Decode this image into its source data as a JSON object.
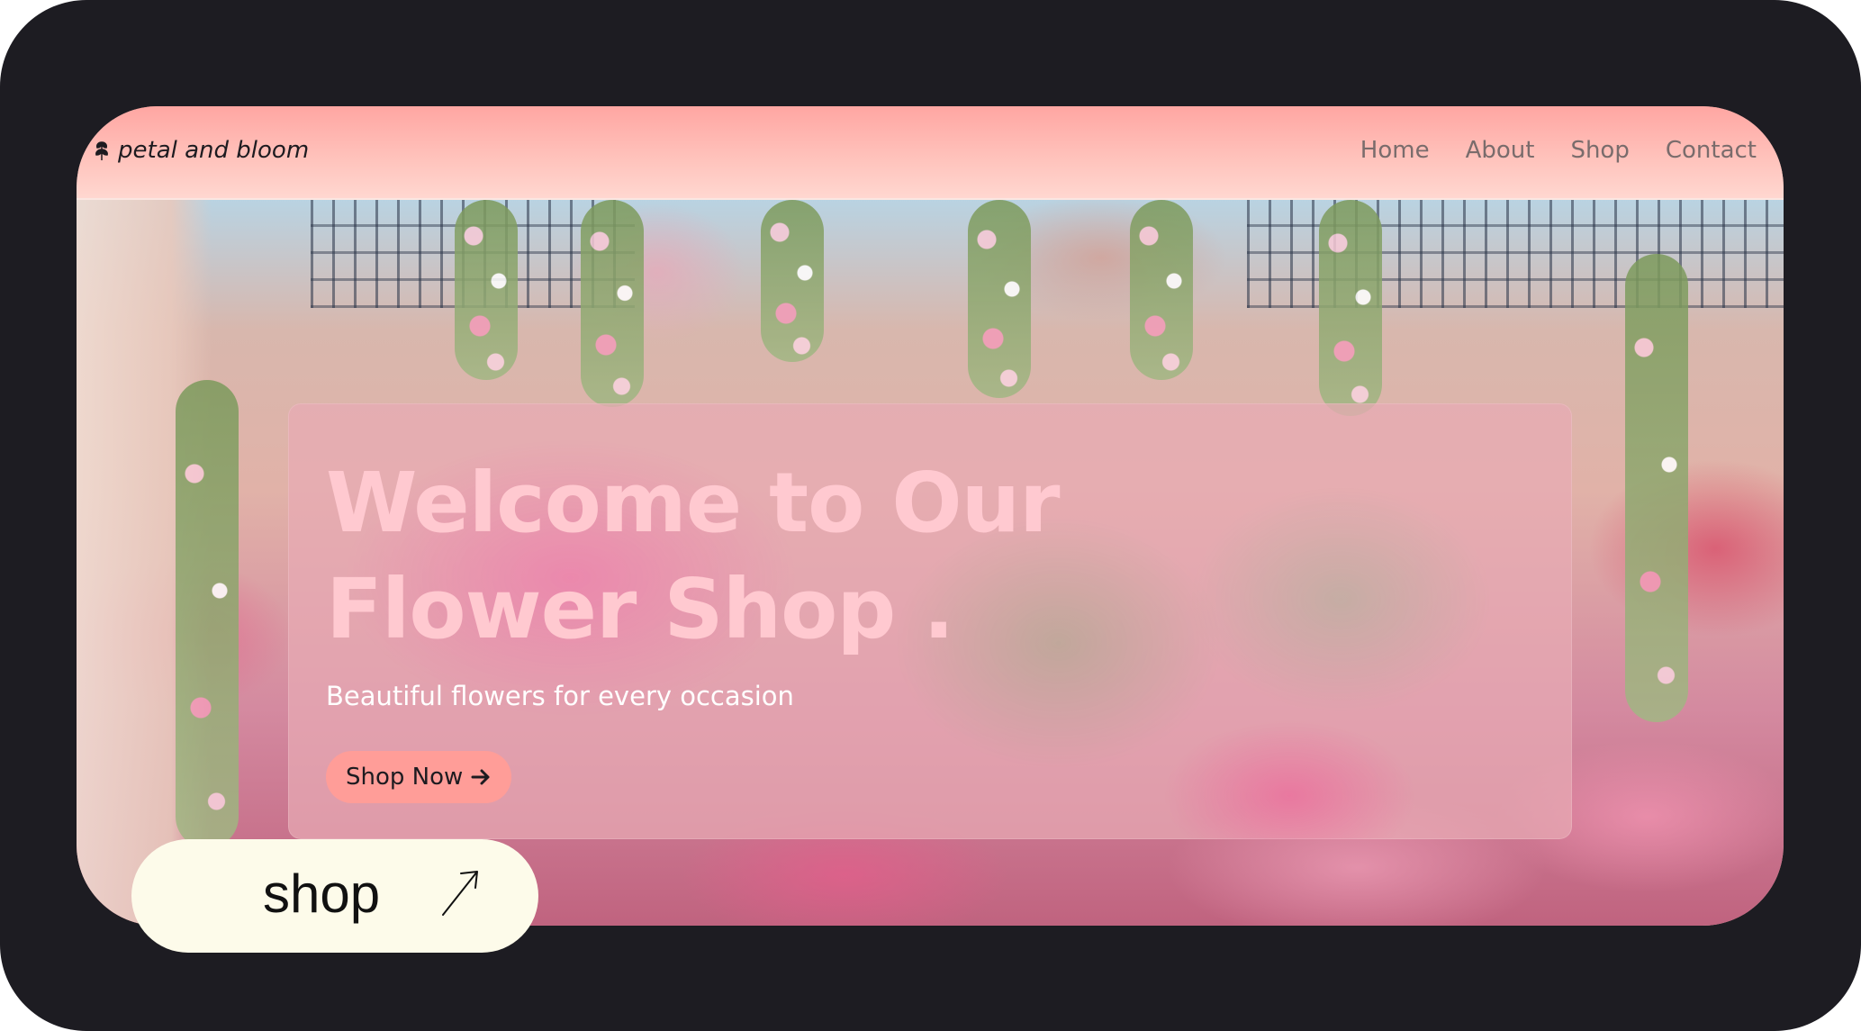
{
  "navbar": {
    "brand": "petal and bloom",
    "brand_icon": "leaf-icon",
    "links": [
      {
        "label": "Home"
      },
      {
        "label": "About"
      },
      {
        "label": "Shop"
      },
      {
        "label": "Contact"
      }
    ]
  },
  "hero": {
    "title": "Welcome to Our Flower Shop .",
    "subtitle": "Beautiful flowers for every occasion",
    "cta_label": "Shop Now",
    "cta_icon": "arrow-right-icon"
  },
  "overlay": {
    "pill_label": "shop",
    "pill_icon": "arrow-up-right-icon"
  },
  "colors": {
    "frame": "#1d1c22",
    "navbar": "#ffa6a2",
    "cta": "#ff9d98",
    "title": "#ffc9d0",
    "pill": "#fdfbea"
  }
}
